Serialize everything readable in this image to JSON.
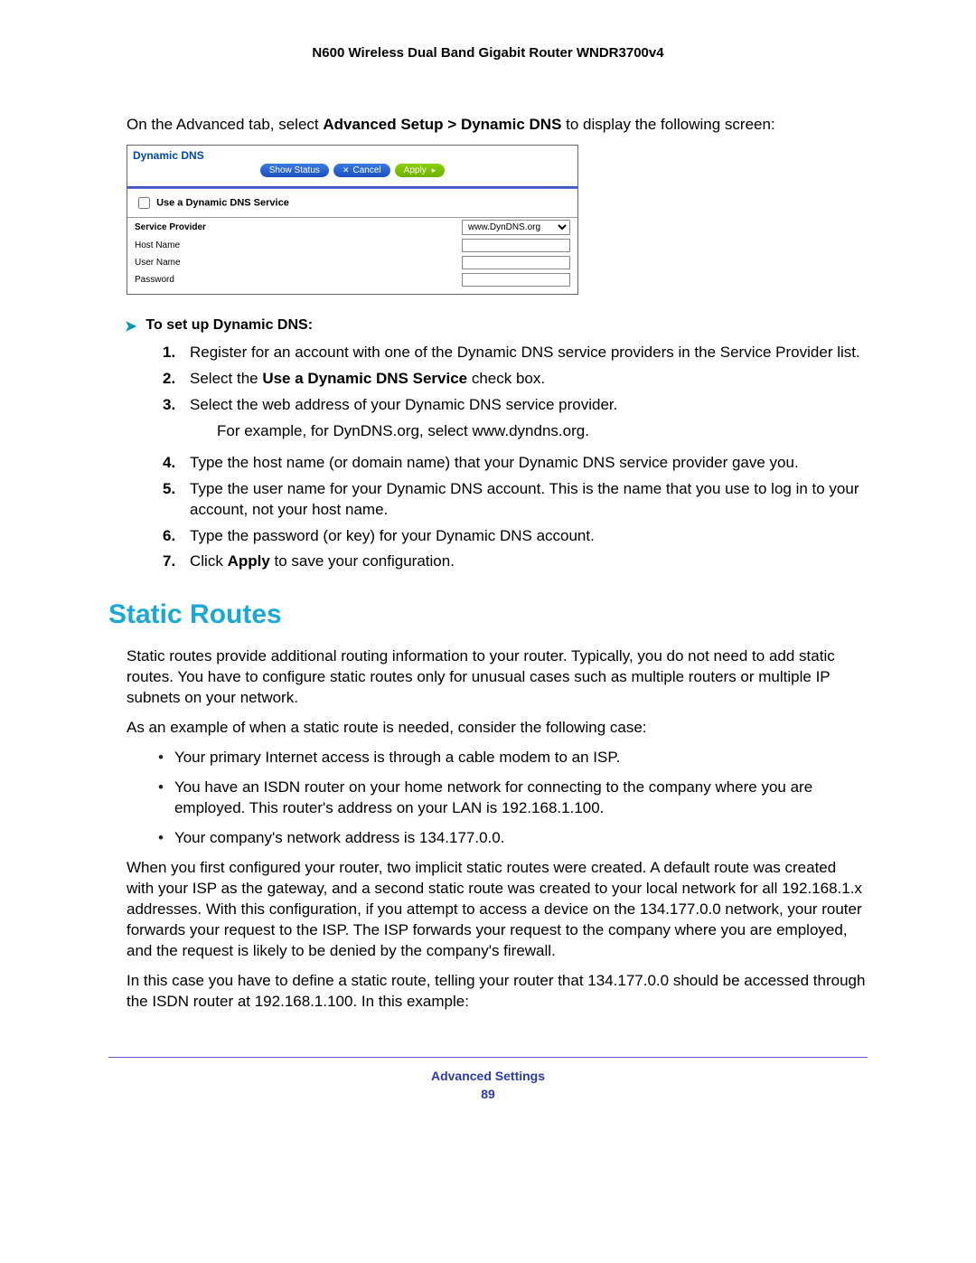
{
  "header": {
    "title": "N600 Wireless Dual Band Gigabit Router WNDR3700v4"
  },
  "intro": {
    "pre": "On the Advanced tab, select ",
    "bold": "Advanced Setup > Dynamic DNS",
    "post": " to display the following screen:"
  },
  "ddns_panel": {
    "title": "Dynamic DNS",
    "buttons": {
      "show_status": "Show Status",
      "cancel": "Cancel",
      "apply": "Apply"
    },
    "use_service": {
      "label": "Use a Dynamic DNS Service",
      "checked": false
    },
    "rows": {
      "service_provider": {
        "label": "Service Provider",
        "value": "www.DynDNS.org"
      },
      "host_name": {
        "label": "Host Name",
        "value": ""
      },
      "user_name": {
        "label": "User Name",
        "value": ""
      },
      "password": {
        "label": "Password",
        "value": ""
      }
    }
  },
  "howto_heading": "To set up Dynamic DNS:",
  "steps": [
    {
      "n": "1.",
      "text": "Register for an account with one of the Dynamic DNS service providers in the Service Provider list."
    },
    {
      "n": "2.",
      "pre": "Select the ",
      "bold": "Use a Dynamic DNS Service",
      "post": " check box."
    },
    {
      "n": "3.",
      "text": "Select the web address of your Dynamic DNS service provider.",
      "sub": "For example, for DynDNS.org, select www.dyndns.org."
    },
    {
      "n": "4.",
      "text": "Type the host name (or domain name) that your Dynamic DNS service provider gave you."
    },
    {
      "n": "5.",
      "text": "Type the user name for your Dynamic DNS account. This is the name that you use to log in to your account, not your host name."
    },
    {
      "n": "6.",
      "text": "Type the password (or key) for your Dynamic DNS account."
    },
    {
      "n": "7.",
      "pre": "Click ",
      "bold": "Apply",
      "post": " to save your configuration."
    }
  ],
  "section_heading": "Static Routes",
  "static_para1": "Static routes provide additional routing information to your router. Typically, you do not need to add static routes. You have to configure static routes only for unusual cases such as multiple routers or multiple IP subnets on your network.",
  "static_para2": "As an example of when a static route is needed, consider the following case:",
  "static_bullets": [
    "Your primary Internet access is through a cable modem to an ISP.",
    "You have an ISDN router on your home network for connecting to the company where you are employed. This router's address on your LAN is 192.168.1.100.",
    "Your company's network address is 134.177.0.0."
  ],
  "static_para3": "When you first configured your router, two implicit static routes were created. A default route was created with your ISP as the gateway, and a second static route was created to your local network for all 192.168.1.x addresses. With this configuration, if you attempt to access a device on the 134.177.0.0 network, your router forwards your request to the ISP. The ISP forwards your request to the company where you are employed, and the request is likely to be denied by the company's firewall.",
  "static_para4": "In this case you have to define a static route, telling your router that 134.177.0.0 should be accessed through the ISDN router at 192.168.1.100. In this example:",
  "footer": {
    "section": "Advanced Settings",
    "page": "89"
  }
}
